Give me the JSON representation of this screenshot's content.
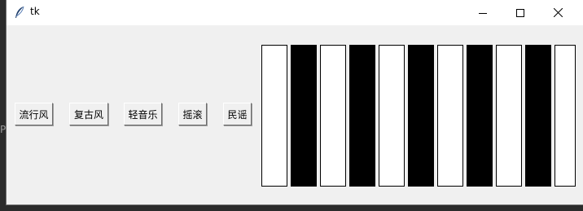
{
  "window": {
    "title": "tk",
    "icon": "feather-icon",
    "controls": [
      "minimize-icon",
      "maximize-icon",
      "close-icon"
    ]
  },
  "style_buttons": [
    {
      "label": "流行风"
    },
    {
      "label": "复古风"
    },
    {
      "label": "轻音乐"
    },
    {
      "label": "摇滚"
    },
    {
      "label": "民谣"
    }
  ],
  "piano": {
    "key_colors": [
      "white",
      "black",
      "white",
      "black",
      "white",
      "black",
      "white",
      "black",
      "white",
      "black",
      "white"
    ]
  },
  "colors": {
    "window_bg": "#f0f0f0",
    "titlebar_bg": "#ffffff",
    "white_key": "#ffffff",
    "black_key": "#000000"
  }
}
